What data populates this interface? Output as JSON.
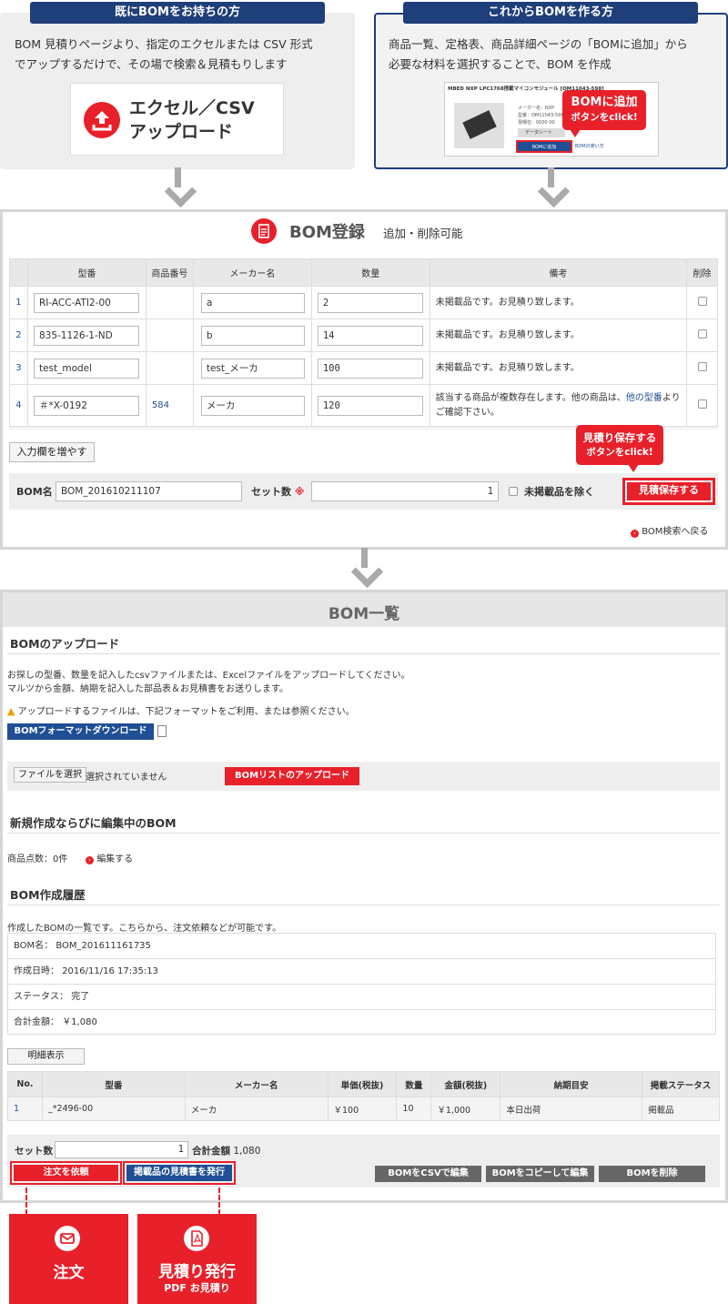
{
  "top_left": {
    "tab": "既にBOMをお持ちの方",
    "desc1": "BOM 見積りページより、指定のエクセルまたは CSV 形式",
    "desc2": "でアップするだけで、その場で検索＆見積もりします",
    "upload_line1": "エクセル／CSV",
    "upload_line2": "アップロード"
  },
  "top_right": {
    "tab": "これからBOMを作る方",
    "desc1": "商品一覧、定格表、商品詳細ページの「BOMに追加」から",
    "desc2": "必要な材料を選択することで、BOM を作成",
    "shot_title": "MBED NXP LPC1768搭載マイコンモジュール [OM11043-598]",
    "shot_maker": "メーカー名：NXP",
    "shot_model": "型番：OM11043-598",
    "shot_stock": "現場在：0000 00",
    "shot_datasheet": "データシート",
    "shot_add": "BOMに追加",
    "shot_howto": "BOMの使い方",
    "callout1": "BOMに追加",
    "callout2": "ボタンをclick!"
  },
  "bom_register": {
    "title": "BOM登録",
    "subtitle": "追加・削除可能",
    "columns": [
      "型番",
      "商品番号",
      "メーカー名",
      "数量",
      "備考",
      "削除"
    ],
    "rows": [
      {
        "no": "1",
        "model": "RI-ACC-ATI2-00",
        "product_no": "",
        "maker": "a",
        "qty": "2",
        "note1": "未掲載品です。お見積り致します。",
        "note2": "",
        "link": "",
        "note_after": ""
      },
      {
        "no": "2",
        "model": "835-1126-1-ND",
        "product_no": "",
        "maker": "b",
        "qty": "14",
        "note1": "未掲載品です。お見積り致します。",
        "note2": "",
        "link": "",
        "note_after": ""
      },
      {
        "no": "3",
        "model": "test_model",
        "product_no": "",
        "maker": "test_メーカ",
        "qty": "100",
        "note1": "未掲載品です。お見積り致します。",
        "note2": "",
        "link": "",
        "note_after": ""
      },
      {
        "no": "4",
        "model": "＃*X-0192",
        "product_no": "584",
        "maker": "メーカ",
        "qty": "120",
        "note1": "該当する商品が複数存在します。他の商品は、",
        "link": "他の型番",
        "note_after": "より",
        "note2": "ご確認下さい。"
      }
    ],
    "add_rows_button": "入力欄を増やす",
    "bom_name_label": "BOM名",
    "bom_name_value": "BOM_201610211107",
    "set_label": "セット数",
    "set_required": "※",
    "set_value": "1",
    "exclude_label": "未掲載品を除く",
    "save_button": "見積保存する",
    "callout1": "見積り保存する",
    "callout2": "ボタンをclick!",
    "back_link": "BOM検索へ戻る"
  },
  "bom_list": {
    "title": "BOM一覧",
    "upload_title": "BOMのアップロード",
    "upload_desc1": "お探しの型番、数量を記入したcsvファイルまたは、Excelファイルをアップロードしてください。",
    "upload_desc2": "マルツから金額、納期を記入した部品表＆お見積書をお送りします。",
    "warning": "アップロードするファイルは、下記フォーマットをご利用、または参照ください。",
    "format_button": "BOMフォーマットダウンロード",
    "file_button": "ファイルを選択",
    "file_status": "選択されていません",
    "upload_button": "BOMリストのアップロード",
    "editing_title": "新規作成ならびに編集中のBOM",
    "item_count": "商品点数：0件",
    "edit_link": "編集する",
    "history_title": "BOM作成履歴",
    "history_desc": "作成したBOMの一覧です。こちらから、注文依頼などが可能です。",
    "info": [
      {
        "label": "BOM名",
        "value": "BOM_201611161735"
      },
      {
        "label": "作成日時",
        "value": "2016/11/16 17:35:13"
      },
      {
        "label": "ステータス",
        "value": "完了"
      },
      {
        "label": "合計金額",
        "value": "￥1,080"
      }
    ],
    "detail_button": "明細表示",
    "columns": [
      "No.",
      "型番",
      "メーカー名",
      "単価(税抜)",
      "数量",
      "金額(税抜)",
      "納期目安",
      "掲載ステータス"
    ],
    "rows": [
      {
        "no": "1",
        "model": "_*2496-00",
        "maker": "メーカ",
        "unit": "￥100",
        "qty": "10",
        "amount": "￥1,000",
        "delivery": "本日出荷",
        "status": "掲載品"
      }
    ],
    "set_label": "セット数",
    "set_value": "1",
    "total_label": "合計金額",
    "total_value": "1,080",
    "order_button": "注文を依頼",
    "quote_button": "掲載品の見積書を発行",
    "csv_edit_button": "BOMをCSVで編集",
    "copy_edit_button": "BOMをコピーして編集",
    "delete_button": "BOMを削除"
  },
  "bottom": {
    "order_label": "注文",
    "quote_label": "見積り発行",
    "quote_sub": "PDF お見積り"
  }
}
